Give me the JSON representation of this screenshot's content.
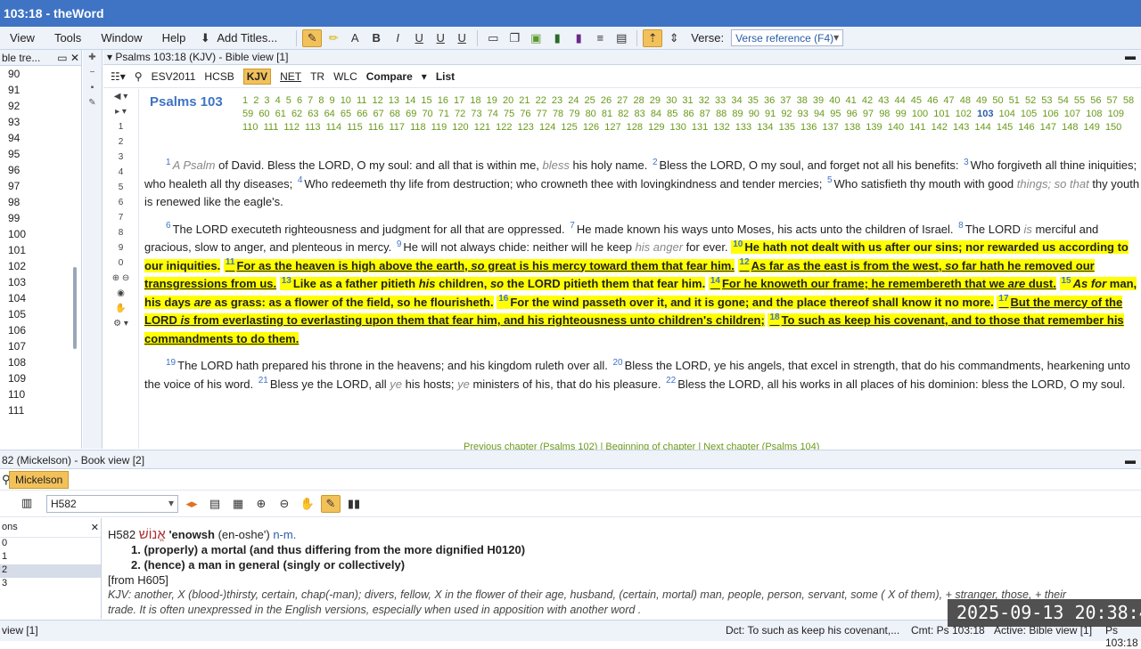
{
  "window": {
    "title": "103:18 - theWord"
  },
  "menu": [
    "View",
    "Tools",
    "Window",
    "Help"
  ],
  "toolbar": {
    "add_titles": "Add Titles...",
    "verse_label": "Verse:",
    "verse_value": "Verse reference (F4)"
  },
  "left_tree": {
    "header": "ble tre...",
    "numbers": [
      "90",
      "91",
      "92",
      "93",
      "94",
      "95",
      "96",
      "97",
      "98",
      "99",
      "100",
      "101",
      "102",
      "103",
      "104",
      "105",
      "106",
      "107",
      "108",
      "109",
      "110",
      "111"
    ]
  },
  "bible": {
    "header": "Psalms 103:18 (KJV)  - Bible view [1]",
    "versions": [
      "ESV2011",
      "HCSB",
      "KJV",
      "NET",
      "TR",
      "WLC",
      "Compare",
      "List"
    ],
    "left_numbers": [
      "1",
      "2",
      "3",
      "4",
      "5",
      "6",
      "7",
      "8",
      "9",
      "0"
    ],
    "chapter_title": "Psalms 103",
    "chapters": [
      "1",
      "2",
      "3",
      "4",
      "5",
      "6",
      "7",
      "8",
      "9",
      "10",
      "11",
      "12",
      "13",
      "14",
      "15",
      "16",
      "17",
      "18",
      "19",
      "20",
      "21",
      "22",
      "23",
      "24",
      "25",
      "26",
      "27",
      "28",
      "29",
      "30",
      "31",
      "32",
      "33",
      "34",
      "35",
      "36",
      "37",
      "38",
      "39",
      "40",
      "41",
      "42",
      "43",
      "44",
      "45",
      "46",
      "47",
      "48",
      "49",
      "50",
      "51",
      "52",
      "53",
      "54",
      "55",
      "56",
      "57",
      "58",
      "59",
      "60",
      "61",
      "62",
      "63",
      "64",
      "65",
      "66",
      "67",
      "68",
      "69",
      "70",
      "71",
      "72",
      "73",
      "74",
      "75",
      "76",
      "77",
      "78",
      "79",
      "80",
      "81",
      "82",
      "83",
      "84",
      "85",
      "86",
      "87",
      "88",
      "89",
      "90",
      "91",
      "92",
      "93",
      "94",
      "95",
      "96",
      "97",
      "98",
      "99",
      "100",
      "101",
      "102",
      "103",
      "104",
      "105",
      "106",
      "107",
      "108",
      "109",
      "110",
      "111",
      "112",
      "113",
      "114",
      "115",
      "116",
      "117",
      "118",
      "119",
      "120",
      "121",
      "122",
      "123",
      "124",
      "125",
      "126",
      "127",
      "128",
      "129",
      "130",
      "131",
      "132",
      "133",
      "134",
      "135",
      "136",
      "137",
      "138",
      "139",
      "140",
      "141",
      "142",
      "143",
      "144",
      "145",
      "146",
      "147",
      "148",
      "149",
      "150"
    ],
    "current_chapter": "103",
    "nav": "Previous chapter (Psalms 102) | Beginning of chapter | Next chapter (Psalms 104)"
  },
  "book": {
    "header": "82 (Mickelson) - Book view [2]",
    "tab": "Mickelson",
    "search": "H582",
    "left_header": "ons",
    "left_rows": [
      "0",
      "1",
      "2",
      "3"
    ],
    "entry_id": "H582",
    "hebrew": "אֱנוֹשׁ",
    "translit": "'enowsh",
    "pron": "(en-oshe')",
    "pos": "n-m.",
    "def1": "1. (properly) a mortal (and thus differing from the more dignified H0120)",
    "def2": "2. (hence) a man in general (singly or collectively)",
    "from": "[from H605]",
    "kjv": "KJV: another, X (blood-)thirsty, certain, chap(-man); divers, fellow, X in the flower of their age, husband, (certain, mortal) man, people, person, servant, some ( X of them), + stranger, those, + their",
    "kjv2": "trade. It is often unexpressed in the English versions, especially when used in apposition with another word ."
  },
  "status": {
    "left": "view [1]",
    "dct": "Dct:  To such as keep his covenant,...",
    "cmt": "Cmt: Ps 103:18",
    "active": "Active: Bible view [1]",
    "ref": "Ps 103:18"
  },
  "clock": "2025-09-13  20:38:4"
}
